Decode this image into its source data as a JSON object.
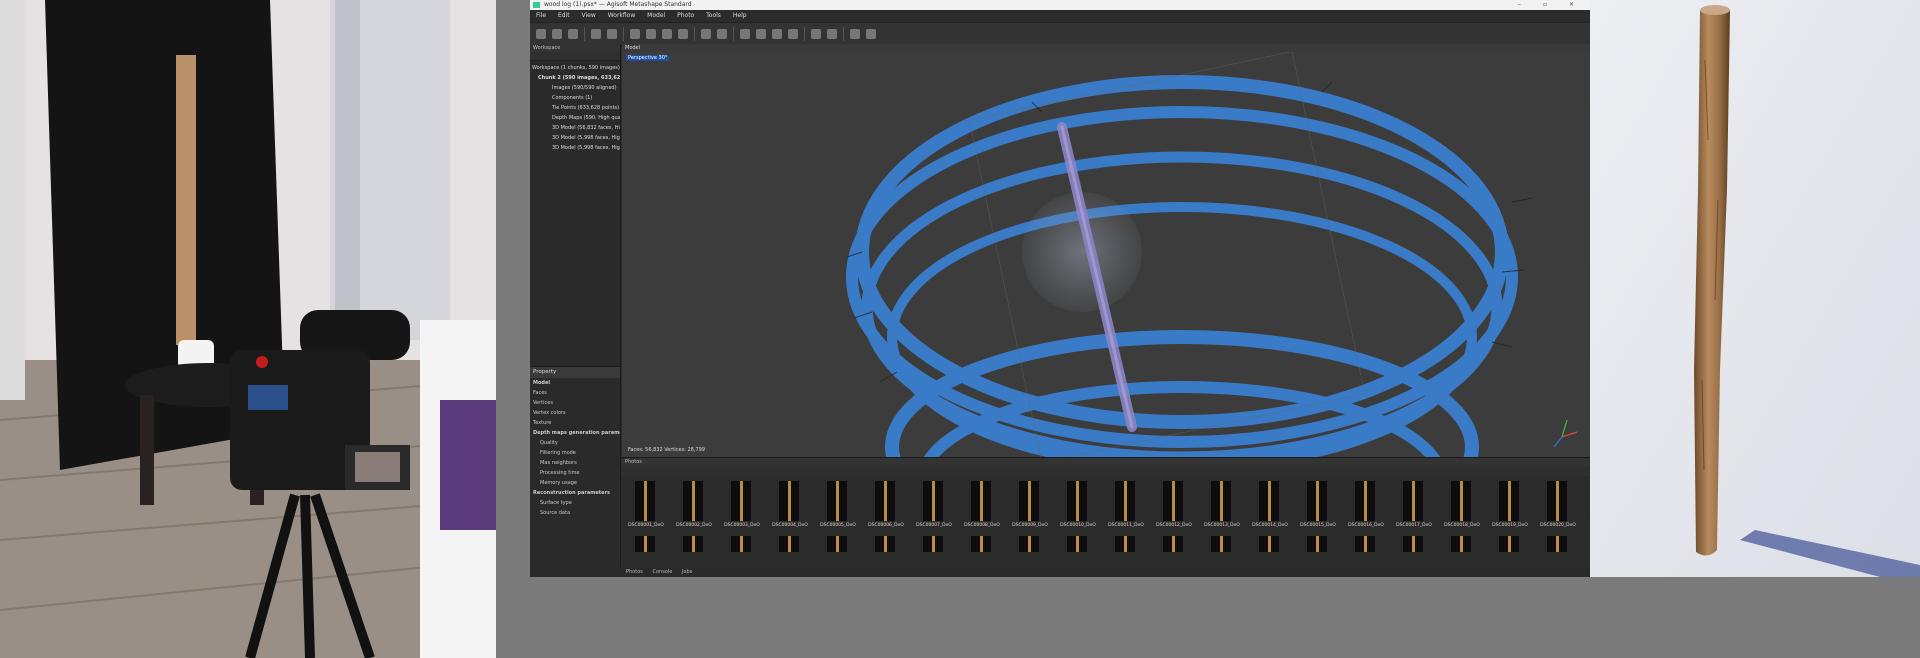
{
  "app": {
    "title": "wood log (1).psx* — Agisoft Metashape Standard",
    "menu": [
      "File",
      "Edit",
      "View",
      "Workflow",
      "Model",
      "Photo",
      "Tools",
      "Help"
    ]
  },
  "workspace": {
    "panel_title": "Workspace",
    "tree": [
      "Workspace (1 chunks, 590 images)",
      "Chunk 2 (590 images, 633,628 t",
      "Images (590/590 aligned)",
      "Components (1)",
      "Tie Points (633,628 points)",
      "Depth Maps (590, High quality",
      "3D Model (56,832 faces, High",
      "3D Model (5,998 faces, High q",
      "3D Model (5,998 faces, High q"
    ]
  },
  "property": {
    "header": "Property",
    "items": [
      "Model",
      "Faces",
      "Vertices",
      "Vertex colors",
      "Texture",
      "Depth maps generation parameters",
      "Quality",
      "Filtering mode",
      "Max neighbors",
      "Processing time",
      "Memory usage",
      "Reconstruction parameters",
      "Surface type",
      "Source data"
    ]
  },
  "viewport": {
    "tab": "Model",
    "label": "Perspective 30°",
    "status": "Faces: 56,832  Vertices: 28,799"
  },
  "photos": {
    "panel_title": "Photos",
    "row1": [
      "DSC00001_DxO",
      "DSC00002_DxO",
      "DSC00003_DxO",
      "DSC00004_DxO",
      "DSC00005_DxO",
      "DSC00006_DxO",
      "DSC00007_DxO",
      "DSC00008_DxO",
      "DSC00009_DxO",
      "DSC00010_DxO",
      "DSC00011_DxO",
      "DSC00012_DxO",
      "DSC00013_DxO",
      "DSC00014_DxO",
      "DSC00015_DxO",
      "DSC00016_DxO",
      "DSC00017_DxO",
      "DSC00018_DxO",
      "DSC00019_DxO",
      "DSC00020_DxO"
    ]
  },
  "bottom_tabs": [
    "Photos",
    "Console",
    "Jobs"
  ],
  "colors": {
    "camera_blue": "#3a7bc8",
    "viewport_bg": "#3c3c3c",
    "model_purple": "#8b84c4"
  }
}
